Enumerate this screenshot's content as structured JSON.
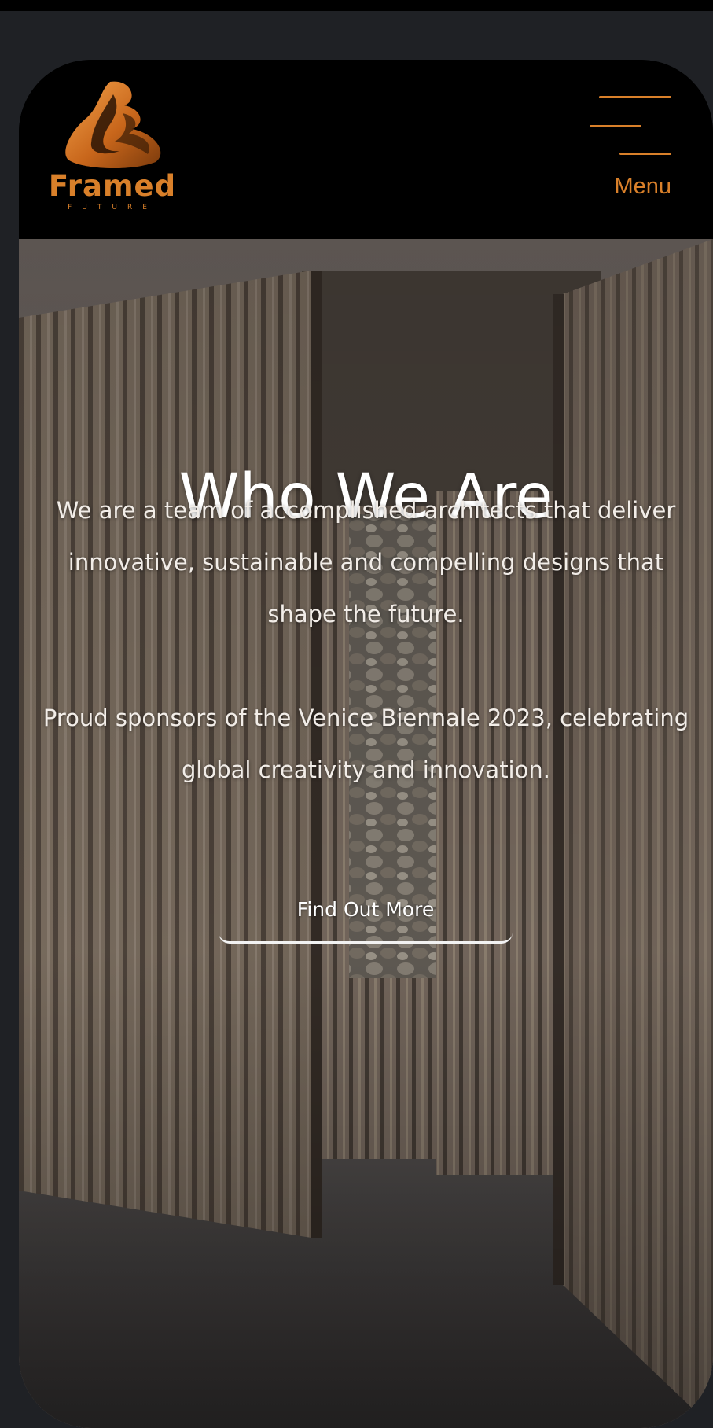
{
  "brand": {
    "name": "Framed",
    "tagline": "FUTURE",
    "accent_color": "#d9802a"
  },
  "header": {
    "menu_icon": "hamburger-menu-icon",
    "menu_label": "Menu"
  },
  "hero": {
    "title": "Who We Are",
    "paragraph_1": "We are a team of accomplished architects that deliver innovative, sustainable and compelling designs that shape the future.",
    "paragraph_2": "Proud sponsors of the Venice Biennale 2023, celebrating global creativity and innovation.",
    "cta_label": "Find Out More",
    "background_image": "wooden-slat-walls-corridor-photo"
  }
}
